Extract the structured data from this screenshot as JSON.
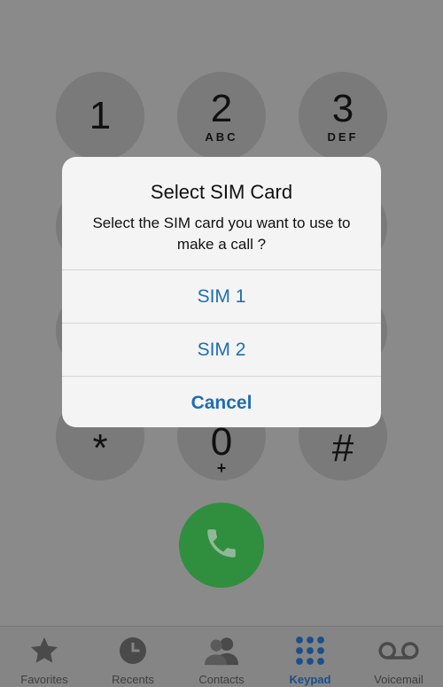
{
  "keypad": {
    "keys": [
      {
        "digit": "1",
        "letters": ""
      },
      {
        "digit": "2",
        "letters": "ABC"
      },
      {
        "digit": "3",
        "letters": "DEF"
      },
      {
        "digit": "*",
        "letters": ""
      },
      {
        "digit": "0",
        "letters": "+"
      },
      {
        "digit": "#",
        "letters": ""
      }
    ]
  },
  "dialog": {
    "title": "Select SIM Card",
    "message": "Select the SIM card you want to use to make a call ?",
    "options": [
      "SIM 1",
      "SIM 2"
    ],
    "cancel_label": "Cancel"
  },
  "tabbar": {
    "tabs": [
      {
        "label": "Favorites",
        "icon": "star-icon"
      },
      {
        "label": "Recents",
        "icon": "clock-icon"
      },
      {
        "label": "Contacts",
        "icon": "contacts-icon"
      },
      {
        "label": "Keypad",
        "icon": "keypad-icon"
      },
      {
        "label": "Voicemail",
        "icon": "voicemail-icon"
      }
    ],
    "active": "Keypad"
  },
  "colors": {
    "accent": "#1f6db3",
    "call_green": "#2f8f3e"
  }
}
